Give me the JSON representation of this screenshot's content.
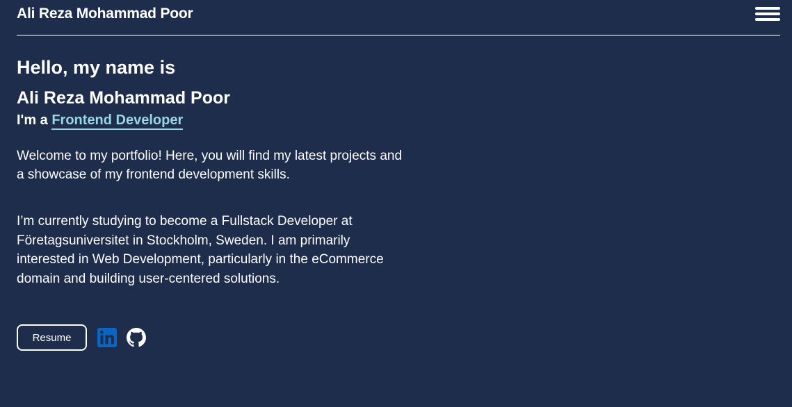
{
  "header": {
    "title": "Ali Reza Mohammad Poor",
    "menu_icon": "hamburger-menu-icon"
  },
  "hero": {
    "greeting": "Hello, my name is",
    "name": "Ali Reza Mohammad Poor",
    "role_prefix": "I'm a",
    "role_link": "Frontend Developer",
    "intro": "Welcome to my portfolio! Here, you will find my latest projects and a showcase of my frontend development skills.",
    "bio": "I’m currently studying to become a Fullstack Developer at Företagsuniversitet in Stockholm, Sweden. I am primarily interested in Web Development, particularly in the eCommerce domain and building user-centered solutions."
  },
  "actions": {
    "resume_label": "Resume",
    "social": [
      {
        "icon": "linkedin-icon"
      },
      {
        "icon": "github-icon"
      }
    ]
  },
  "colors": {
    "background": "#1d2d4b",
    "text": "#ffffff",
    "accent": "#9ad5e4",
    "linkedin": "#0a66c2",
    "divider": "#8e9aab"
  }
}
